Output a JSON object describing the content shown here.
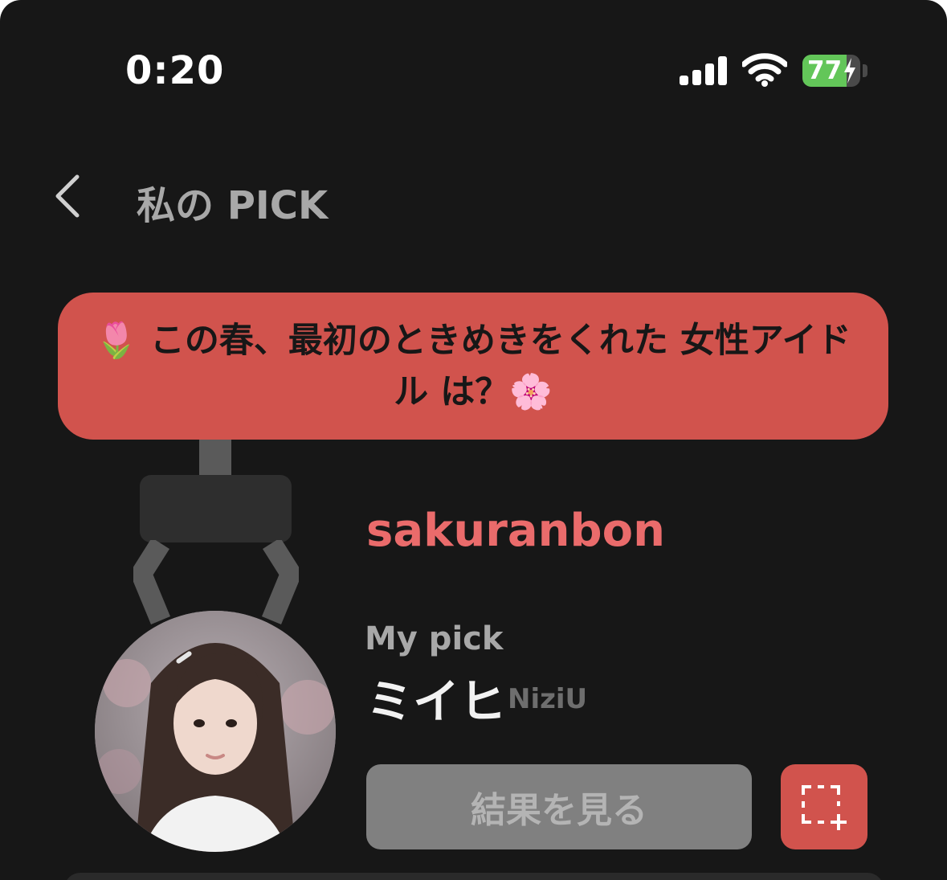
{
  "status_bar": {
    "time": "0:20",
    "battery_level": "77",
    "battery_fraction": 0.77,
    "signal_bars": 4
  },
  "nav": {
    "back_icon": "chevron-left-icon",
    "title": "私の PICK"
  },
  "question": {
    "text": "🌷 この春、最初のときめきをくれた 女性アイドル は？🌸"
  },
  "pick": {
    "username": "sakuranbon",
    "label": "My pick",
    "idol_name": "ミイヒ",
    "idol_group": "NiziU"
  },
  "actions": {
    "result_label": "結果を見る",
    "capture_icon": "screenshot-add-icon"
  },
  "colors": {
    "background": "#171717",
    "accent": "#d1534d",
    "username": "#ea6b6b",
    "button_gray": "#808080"
  }
}
